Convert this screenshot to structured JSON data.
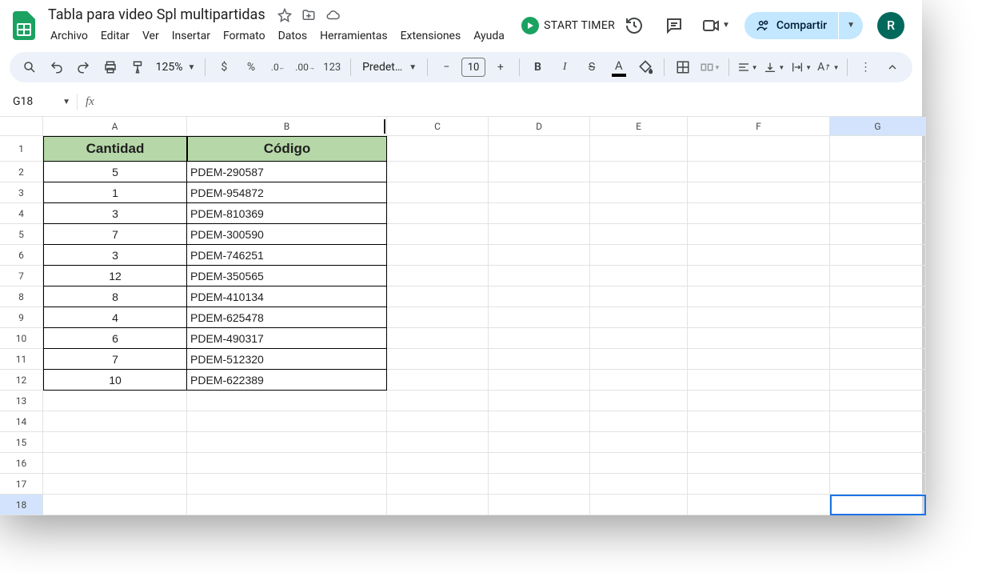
{
  "doc": {
    "title": "Tabla para video Spl multipartidas"
  },
  "menu": {
    "archivo": "Archivo",
    "editar": "Editar",
    "ver": "Ver",
    "insertar": "Insertar",
    "formato": "Formato",
    "datos": "Datos",
    "herramientas": "Herramientas",
    "extensiones": "Extensiones",
    "ayuda": "Ayuda"
  },
  "timer": {
    "label": "START TIMER"
  },
  "share": {
    "label": "Compartir"
  },
  "avatar": {
    "initial": "R"
  },
  "toolbar": {
    "zoom": "125%",
    "font": "Predet…",
    "fontsize": "10"
  },
  "namebox": {
    "value": "G18"
  },
  "columns": [
    "A",
    "B",
    "C",
    "D",
    "E",
    "F",
    "G"
  ],
  "rows_visible": 18,
  "headers": {
    "cantidad": "Cantidad",
    "codigo": "Código"
  },
  "data": [
    {
      "cantidad": "5",
      "codigo": "PDEM-290587"
    },
    {
      "cantidad": "1",
      "codigo": "PDEM-954872"
    },
    {
      "cantidad": "3",
      "codigo": "PDEM-810369"
    },
    {
      "cantidad": "7",
      "codigo": "PDEM-300590"
    },
    {
      "cantidad": "3",
      "codigo": "PDEM-746251"
    },
    {
      "cantidad": "12",
      "codigo": "PDEM-350565"
    },
    {
      "cantidad": "8",
      "codigo": "PDEM-410134"
    },
    {
      "cantidad": "4",
      "codigo": "PDEM-625478"
    },
    {
      "cantidad": "6",
      "codigo": "PDEM-490317"
    },
    {
      "cantidad": "7",
      "codigo": "PDEM-512320"
    },
    {
      "cantidad": "10",
      "codigo": "PDEM-622389"
    }
  ],
  "selected": {
    "row": 18,
    "col": "G"
  }
}
